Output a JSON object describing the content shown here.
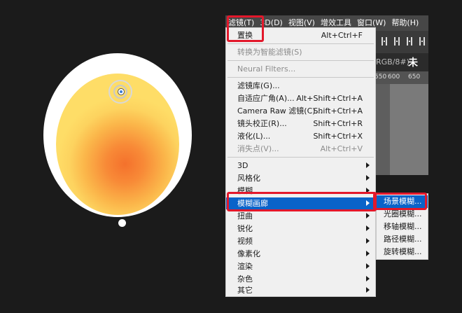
{
  "menubar": {
    "items": [
      "滤镜(T)",
      "3D(D)",
      "视图(V)",
      "增效工具",
      "窗口(W)",
      "帮助(H)"
    ]
  },
  "document": {
    "tab_label": "RGB/8#)",
    "close_glyph": "未",
    "ruler_ticks": [
      "550",
      "600",
      "650"
    ]
  },
  "filter_menu": {
    "last_filter": {
      "label": "置换",
      "shortcut": "Alt+Ctrl+F"
    },
    "convert_smart": "转换为智能滤镜(S)",
    "neural_filters": "Neural Filters...",
    "gallery": {
      "label": "滤镜库(G)...",
      "shortcut": ""
    },
    "adaptive_wide": {
      "label": "自适应广角(A)...",
      "shortcut": "Alt+Shift+Ctrl+A"
    },
    "camera_raw": {
      "label": "Camera Raw 滤镜(C)...",
      "shortcut": "Shift+Ctrl+A"
    },
    "lens_correction": {
      "label": "镜头校正(R)...",
      "shortcut": "Shift+Ctrl+R"
    },
    "liquify": {
      "label": "液化(L)...",
      "shortcut": "Shift+Ctrl+X"
    },
    "vanishing_point": {
      "label": "消失点(V)...",
      "shortcut": "Alt+Ctrl+V"
    },
    "groups": [
      "3D",
      "风格化",
      "模糊",
      "模糊画廊",
      "扭曲",
      "锐化",
      "视频",
      "像素化",
      "渲染",
      "杂色",
      "其它"
    ]
  },
  "blur_gallery": {
    "items": [
      "场景模糊...",
      "光圈模糊...",
      "移轴模糊...",
      "路径模糊...",
      "旋转模糊..."
    ]
  },
  "colors": {
    "highlight": "#0a63c9",
    "annotation": "#e3182b"
  }
}
